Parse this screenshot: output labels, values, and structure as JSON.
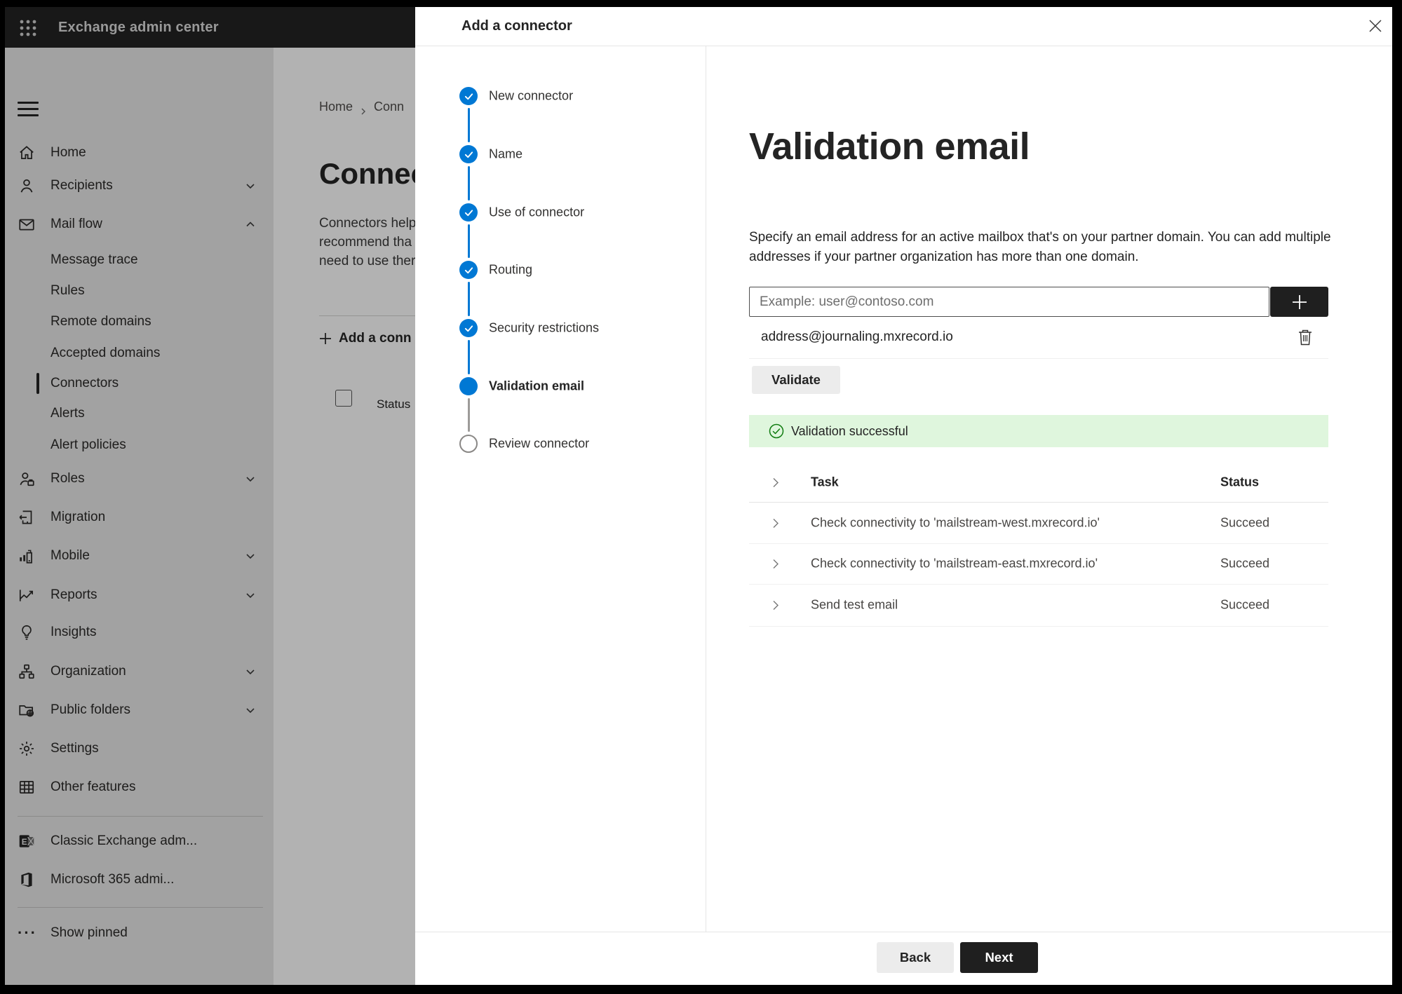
{
  "topbar": {
    "title": "Exchange admin center"
  },
  "sidebar": {
    "items": [
      {
        "label": "Home"
      },
      {
        "label": "Recipients"
      },
      {
        "label": "Mail flow"
      },
      {
        "label": "Message trace"
      },
      {
        "label": "Rules"
      },
      {
        "label": "Remote domains"
      },
      {
        "label": "Accepted domains"
      },
      {
        "label": "Connectors",
        "selected": true
      },
      {
        "label": "Alerts"
      },
      {
        "label": "Alert policies"
      },
      {
        "label": "Roles"
      },
      {
        "label": "Migration"
      },
      {
        "label": "Mobile"
      },
      {
        "label": "Reports"
      },
      {
        "label": "Insights"
      },
      {
        "label": "Organization"
      },
      {
        "label": "Public folders"
      },
      {
        "label": "Settings"
      },
      {
        "label": "Other features"
      },
      {
        "label": "Classic Exchange adm..."
      },
      {
        "label": "Microsoft 365 admi..."
      },
      {
        "label": "Show pinned"
      }
    ]
  },
  "background_page": {
    "breadcrumb_home": "Home",
    "breadcrumb_current": "Conn",
    "heading": "Connect",
    "description_lines": [
      "Connectors help",
      "recommend tha",
      "need to use ther"
    ],
    "add_button_label": "Add a conn",
    "status_header": "Status"
  },
  "panel": {
    "title": "Add a connector",
    "steps": [
      {
        "label": "New connector",
        "state": "done"
      },
      {
        "label": "Name",
        "state": "done"
      },
      {
        "label": "Use of connector",
        "state": "done"
      },
      {
        "label": "Routing",
        "state": "done"
      },
      {
        "label": "Security restrictions",
        "state": "done"
      },
      {
        "label": "Validation email",
        "state": "current"
      },
      {
        "label": "Review connector",
        "state": "pending"
      }
    ],
    "content": {
      "heading": "Validation email",
      "description": "Specify an email address for an active mailbox that's on your partner domain. You can add multiple addresses if your partner organization has more than one domain.",
      "input_placeholder": "Example: user@contoso.com",
      "address": "address@journaling.mxrecord.io",
      "validate_label": "Validate",
      "success_message": "Validation successful",
      "table": {
        "task_header": "Task",
        "status_header": "Status",
        "rows": [
          {
            "task": "Check connectivity to 'mailstream-west.mxrecord.io'",
            "status": "Succeed"
          },
          {
            "task": "Check connectivity to 'mailstream-east.mxrecord.io'",
            "status": "Succeed"
          },
          {
            "task": "Send test email",
            "status": "Succeed"
          }
        ]
      }
    },
    "footer": {
      "back_label": "Back",
      "next_label": "Next"
    }
  },
  "icons": {
    "app-launcher-icon": "3x3 dot grid",
    "hamburger-icon": "three lines",
    "chevron-down-icon": "v",
    "chevron-up-icon": "^",
    "chevron-right-icon": ">",
    "close-icon": "x",
    "plus-icon": "+",
    "trash-icon": "wastebasket",
    "success-check-icon": "circled check",
    "step-check-icon": "check",
    "ellipsis-icon": "..."
  },
  "colors": {
    "accent_blue": "#0078d4",
    "success_bg": "#dff6dd",
    "success_green": "#107c10",
    "primary_button": "#1f1f1f",
    "topbar_bg": "#232323"
  }
}
